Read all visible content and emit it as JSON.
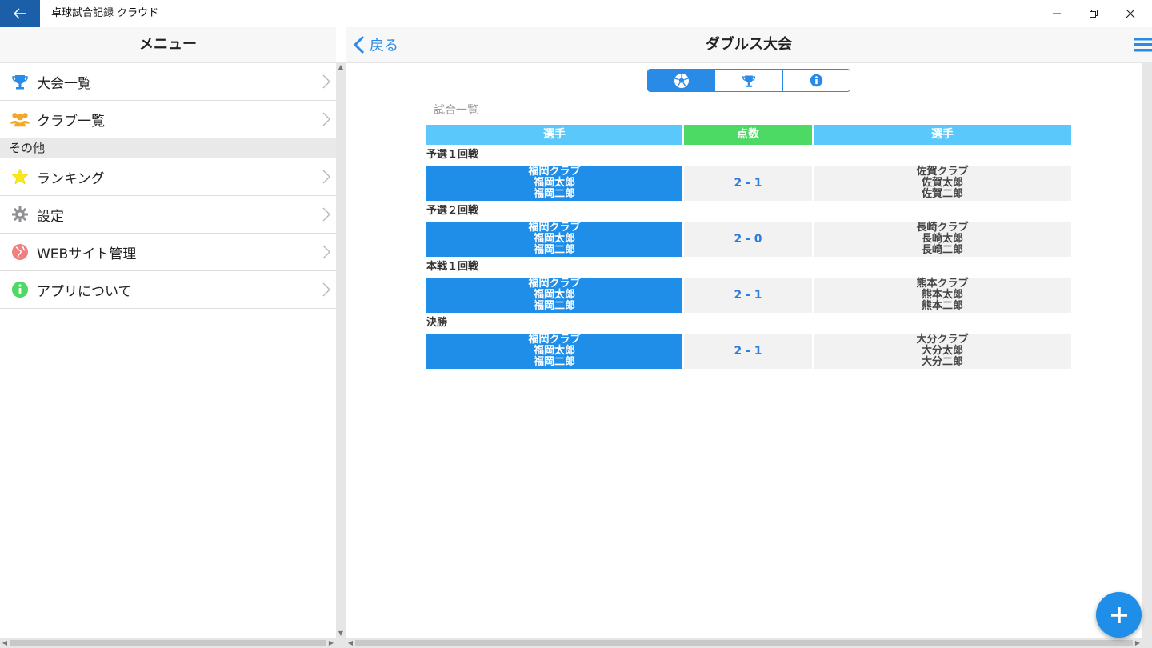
{
  "window": {
    "title": "卓球試合記録 クラウド"
  },
  "menu": {
    "header": "メニュー",
    "items": [
      {
        "label": "大会一覧",
        "icon": "trophy-icon"
      },
      {
        "label": "クラブ一覧",
        "icon": "people-icon"
      }
    ],
    "section_other": "その他",
    "other_items": [
      {
        "label": "ランキング",
        "icon": "star-icon"
      },
      {
        "label": "設定",
        "icon": "gear-icon"
      },
      {
        "label": "WEBサイト管理",
        "icon": "globe-icon"
      },
      {
        "label": "アプリについて",
        "icon": "info-icon"
      }
    ]
  },
  "detail": {
    "back_label": "戻る",
    "title": "ダブルス大会",
    "tabs": [
      {
        "icon": "ball-icon",
        "active": true
      },
      {
        "icon": "trophy-icon",
        "active": false
      },
      {
        "icon": "info-icon",
        "active": false
      }
    ],
    "list_title": "試合一覧",
    "columns": {
      "player_left": "選手",
      "score": "点数",
      "player_right": "選手"
    },
    "matches": [
      {
        "round": "予選１回戦",
        "home": [
          "福岡クラブ",
          "福岡太郎",
          "福岡二郎"
        ],
        "score": "2 - 1",
        "away": [
          "佐賀クラブ",
          "佐賀太郎",
          "佐賀二郎"
        ]
      },
      {
        "round": "予選２回戦",
        "home": [
          "福岡クラブ",
          "福岡太郎",
          "福岡二郎"
        ],
        "score": "2 - 0",
        "away": [
          "長崎クラブ",
          "長崎太郎",
          "長崎二郎"
        ]
      },
      {
        "round": "本戦１回戦",
        "home": [
          "福岡クラブ",
          "福岡太郎",
          "福岡二郎"
        ],
        "score": "2 - 1",
        "away": [
          "熊本クラブ",
          "熊本太郎",
          "熊本二郎"
        ]
      },
      {
        "round": "決勝",
        "home": [
          "福岡クラブ",
          "福岡太郎",
          "福岡二郎"
        ],
        "score": "2 - 1",
        "away": [
          "大分クラブ",
          "大分太郎",
          "大分二郎"
        ]
      }
    ]
  },
  "colors": {
    "accent": "#2a8be6",
    "header_blue": "#5ac8fa",
    "score_green": "#4cd964",
    "home_blue": "#1e8ee9"
  }
}
